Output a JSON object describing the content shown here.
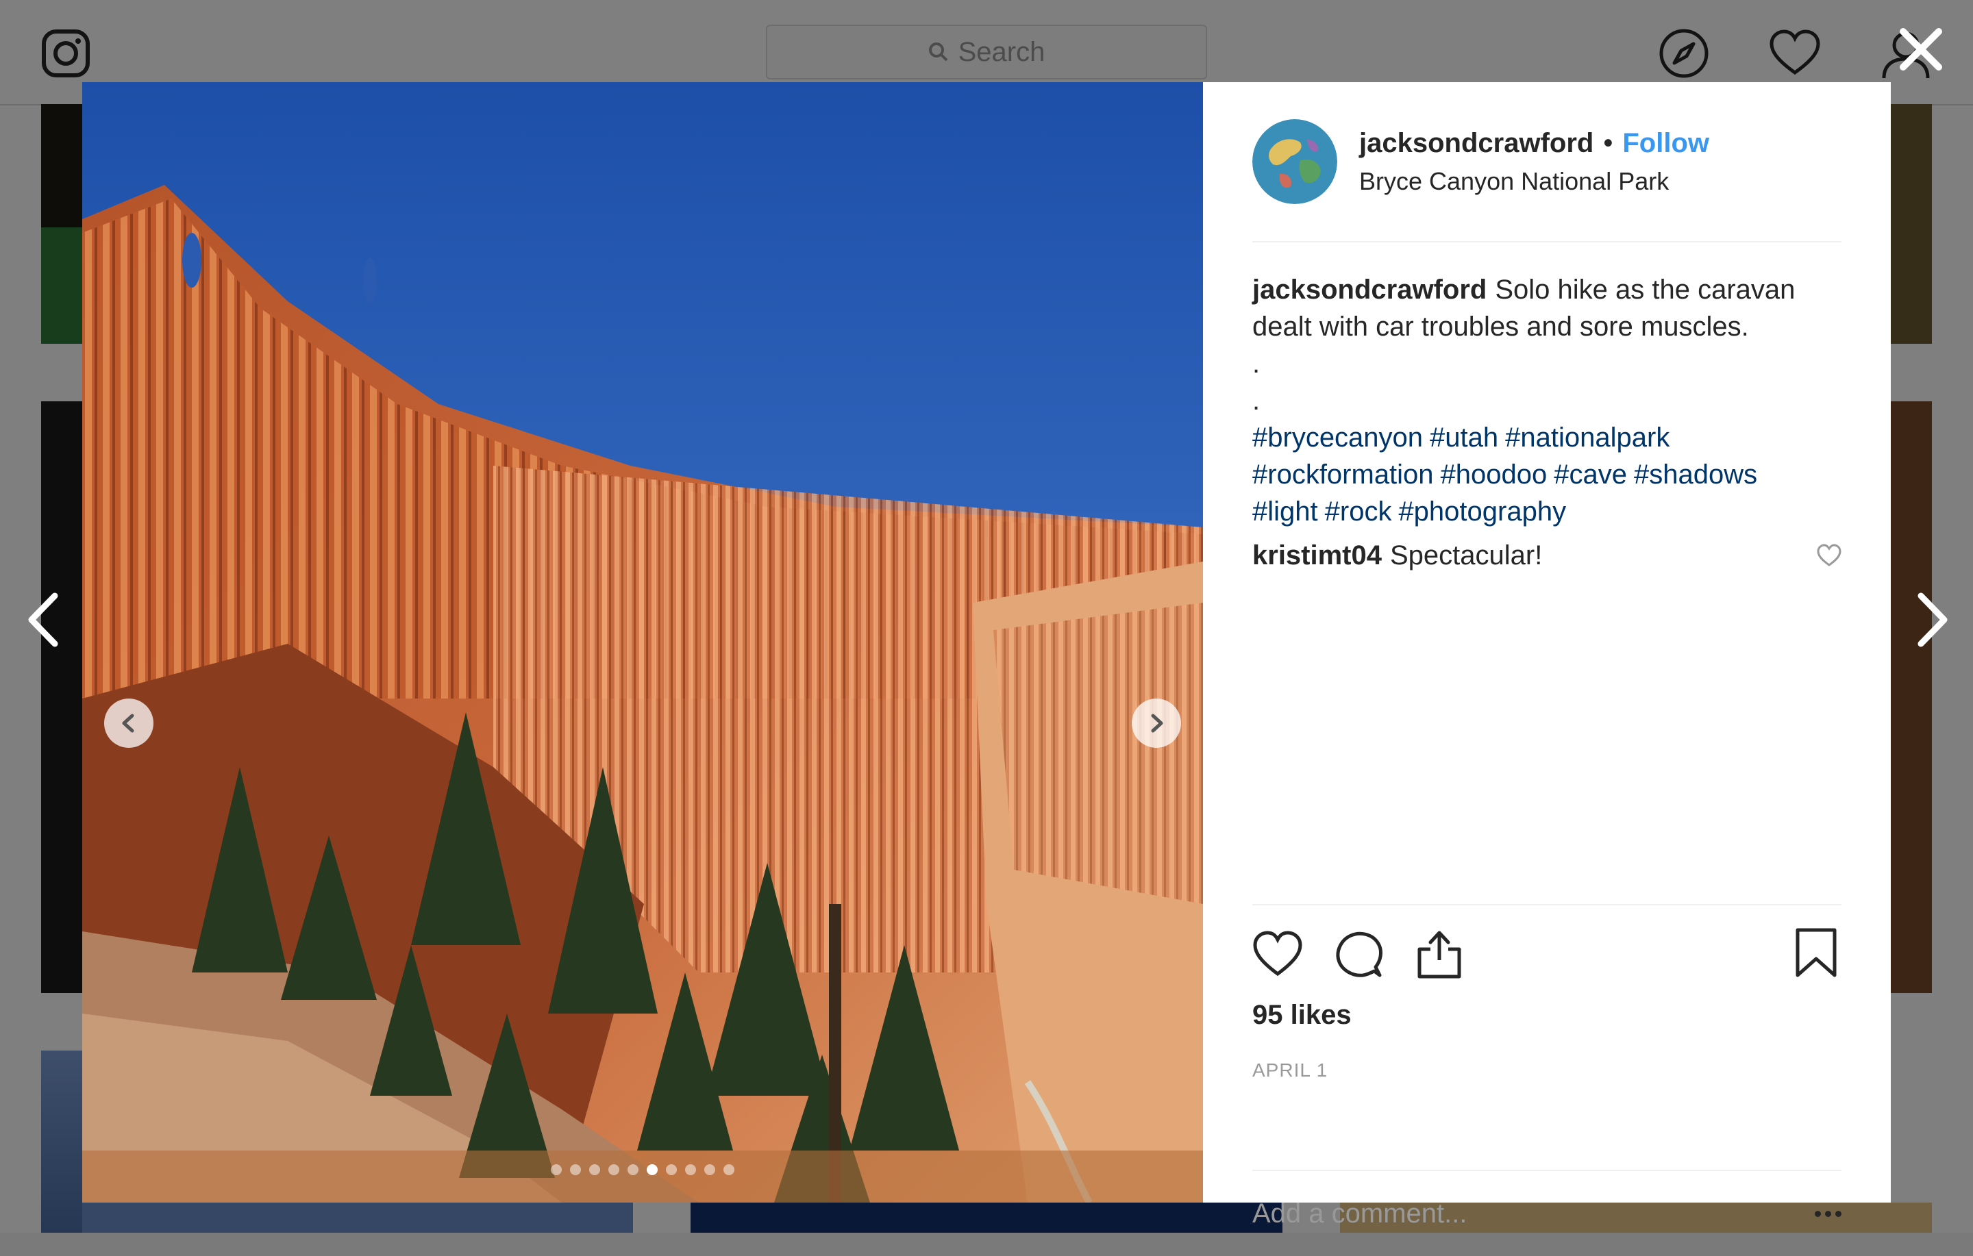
{
  "topbar": {
    "search_placeholder": "Search",
    "icons": [
      "instagram-logo",
      "compass-icon",
      "heart-icon",
      "profile-icon"
    ]
  },
  "modal": {
    "close_icon": "close-icon",
    "carousel": {
      "total_slides": 10,
      "active_index": 5,
      "prev_icon": "chevron-left-icon",
      "next_icon": "chevron-right-icon"
    },
    "post": {
      "username": "jacksondcrawford",
      "follow_label": "Follow",
      "location": "Bryce Canyon National Park",
      "caption": {
        "username": "jacksondcrawford",
        "text": "Solo hike as the caravan dealt with car troubles and sore muscles.",
        "dot1": ".",
        "dot2": ".",
        "hashtags": [
          "#brycecanyon",
          "#utah",
          "#nationalpark",
          "#rockformation",
          "#hoodoo",
          "#cave",
          "#shadows",
          "#light",
          "#rock",
          "#photography"
        ]
      },
      "comments": [
        {
          "username": "kristimt04",
          "text": "Spectacular!"
        }
      ],
      "likes": "95 likes",
      "date": "APRIL 1",
      "add_comment_placeholder": "Add a comment..."
    }
  },
  "colors": {
    "accent": "#3897f0",
    "hashtag": "#003569",
    "text": "#262626",
    "muted": "#999999"
  }
}
